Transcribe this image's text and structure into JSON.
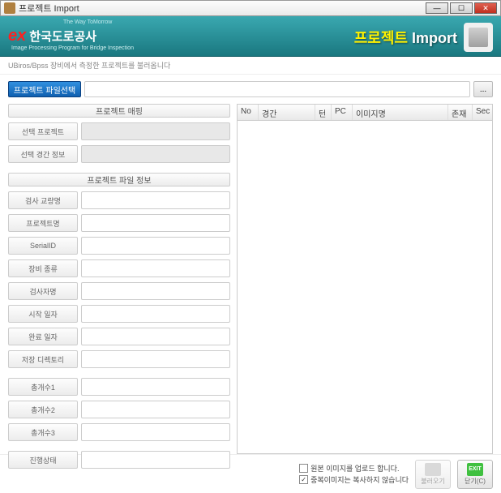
{
  "window": {
    "title": "프로젝트 Import"
  },
  "banner": {
    "logo_tag": "The Way ToMorrow",
    "logo_ex": "ex",
    "logo_text": "한국도로공사",
    "logo_sub": "Image Processing Program for Bridge Inspection",
    "title_a": "프로젝트 ",
    "title_b": "Import"
  },
  "sub_info": "UBiros/Bpss 장비에서 측정한 프로젝트를 불러옵니다",
  "toolbar": {
    "file_select_label": "프로젝트 파일선택",
    "browse_label": "..."
  },
  "sections": {
    "mapping": "프로젝트 매핑",
    "file_info": "프로젝트 파일 정보"
  },
  "labels": {
    "sel_project": "선택 프로젝트",
    "sel_span_info": "선택 경간 정보",
    "bridge_name": "검사 교량명",
    "project_name": "프로젝트명",
    "serial_id": "SerialID",
    "device_type": "장비 종류",
    "inspector": "검사자명",
    "start_date": "시작 일자",
    "end_date": "완료 일자",
    "save_dir": "저장 디렉토리",
    "count1": "총개수1",
    "count2": "총개수2",
    "count3": "총개수3",
    "progress": "진행상태"
  },
  "grid": {
    "no": "No",
    "span": "경간",
    "t": "턴",
    "pc": "PC",
    "img": "이미지명",
    "exist": "존재",
    "sec": "Sec"
  },
  "footer": {
    "chk1_label": "원본 이미지를 업로드 합니다.",
    "chk2_label": "중복이미지는 복사하지 않습니다",
    "chk1_checked": false,
    "chk2_checked": true,
    "import_label": "불러오기",
    "exit_icon": "EXIT",
    "close_label": "닫기(C)"
  }
}
